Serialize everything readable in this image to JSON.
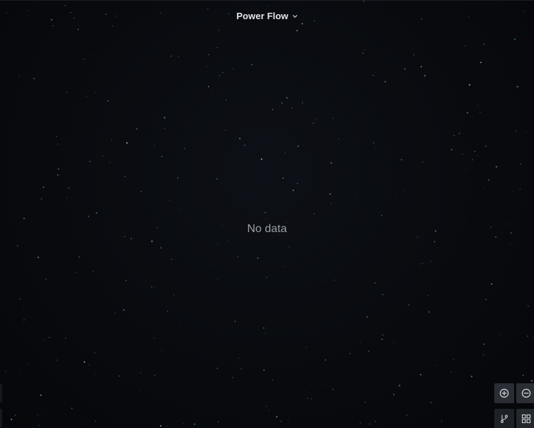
{
  "panel": {
    "title": "Power Flow",
    "empty_message": "No data"
  },
  "icons": {
    "title_menu": "chevron-down-icon",
    "zoom_in": "zoom-in-icon",
    "zoom_out": "zoom-out-icon",
    "layout_graph": "branch-icon",
    "layout_grid": "grid-icon"
  },
  "colors": {
    "background": "#07090d",
    "title_text": "#e4e6ea",
    "empty_text": "#9a9ea6",
    "control_button": "#2a2d33",
    "star_blue": "#4a90c8",
    "star_white": "#c8d0d8"
  }
}
